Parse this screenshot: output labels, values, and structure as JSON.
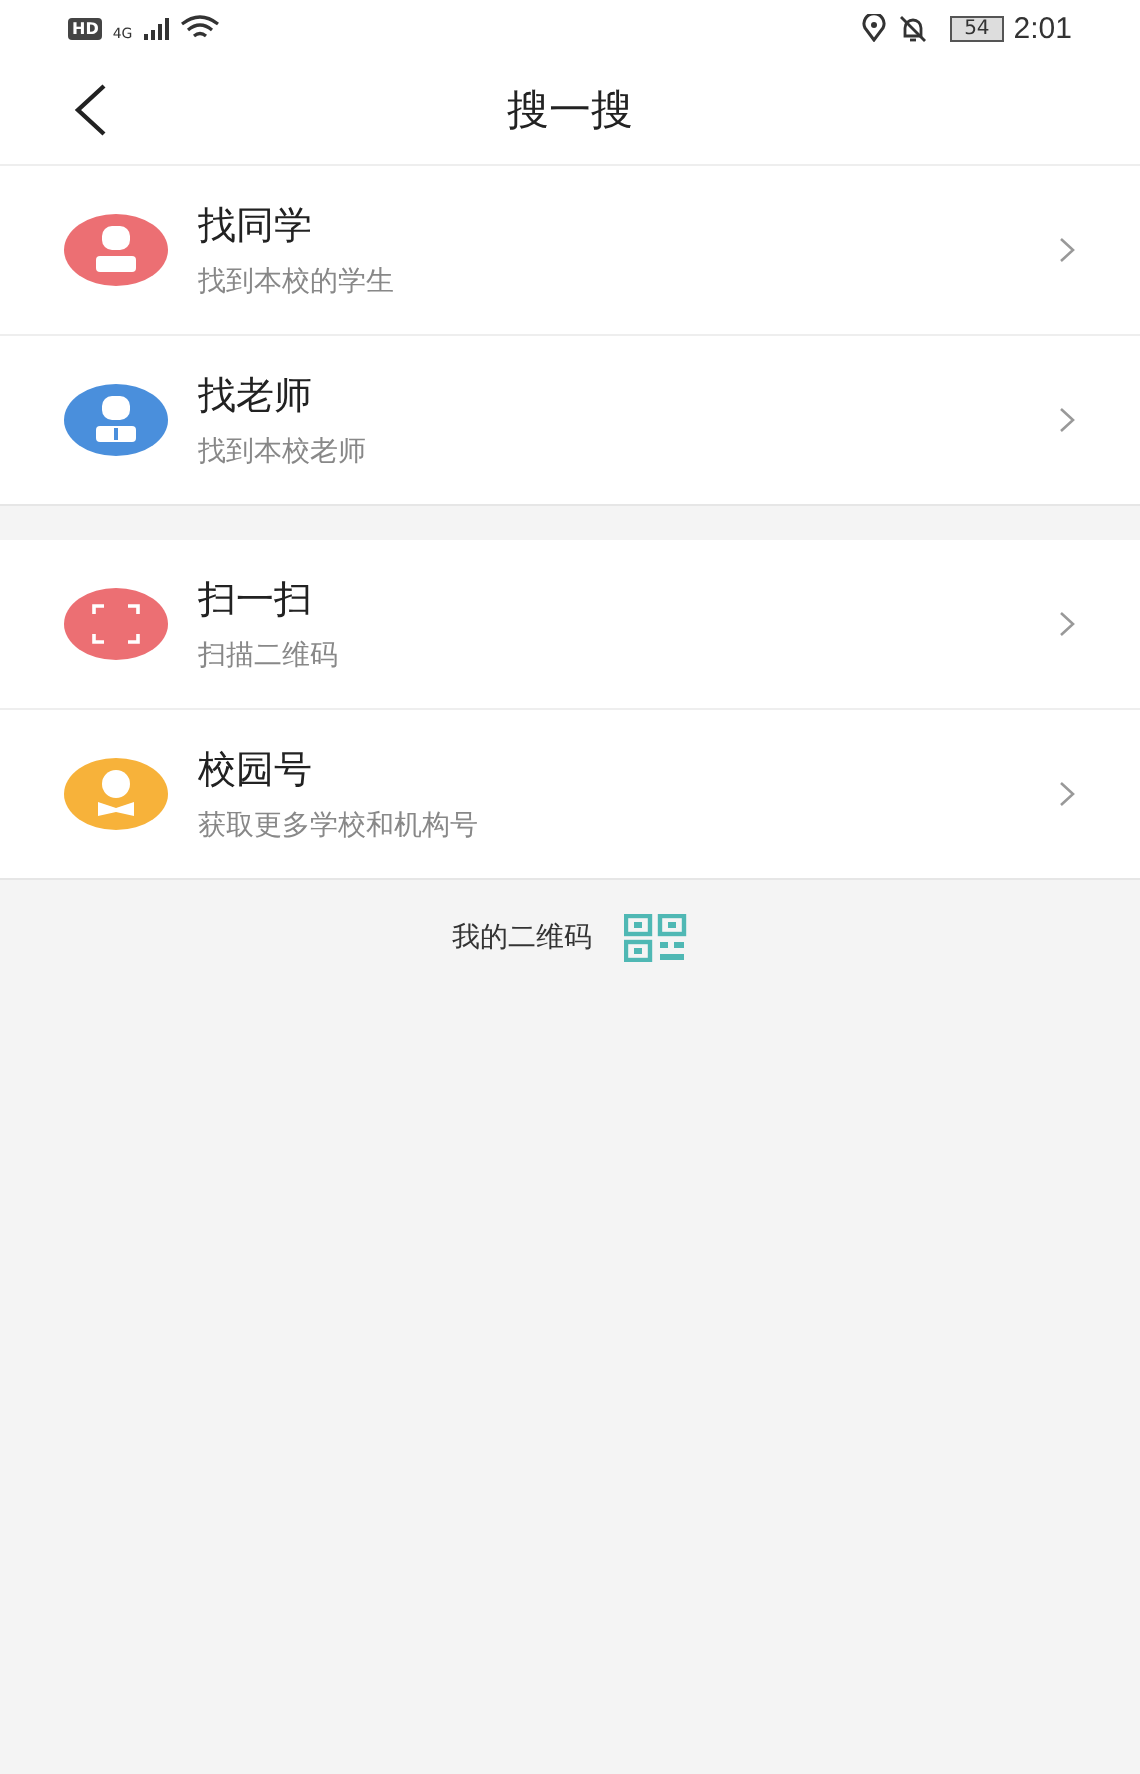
{
  "status_bar": {
    "hd": "HD",
    "network": "4G",
    "battery": "54",
    "time": "2:01"
  },
  "header": {
    "title": "搜一搜"
  },
  "groups": [
    [
      {
        "kind": "student",
        "color": "#ec6f73",
        "title": "找同学",
        "subtitle": "找到本校的学生"
      },
      {
        "kind": "teacher",
        "color": "#4a8fdc",
        "title": "找老师",
        "subtitle": "找到本校老师"
      }
    ],
    [
      {
        "kind": "scan",
        "color": "#ec6f73",
        "title": "扫一扫",
        "subtitle": "扫描二维码"
      },
      {
        "kind": "campus",
        "color": "#f7b23a",
        "title": "校园号",
        "subtitle": "获取更多学校和机构号"
      }
    ]
  ],
  "footer": {
    "label": "我的二维码"
  }
}
